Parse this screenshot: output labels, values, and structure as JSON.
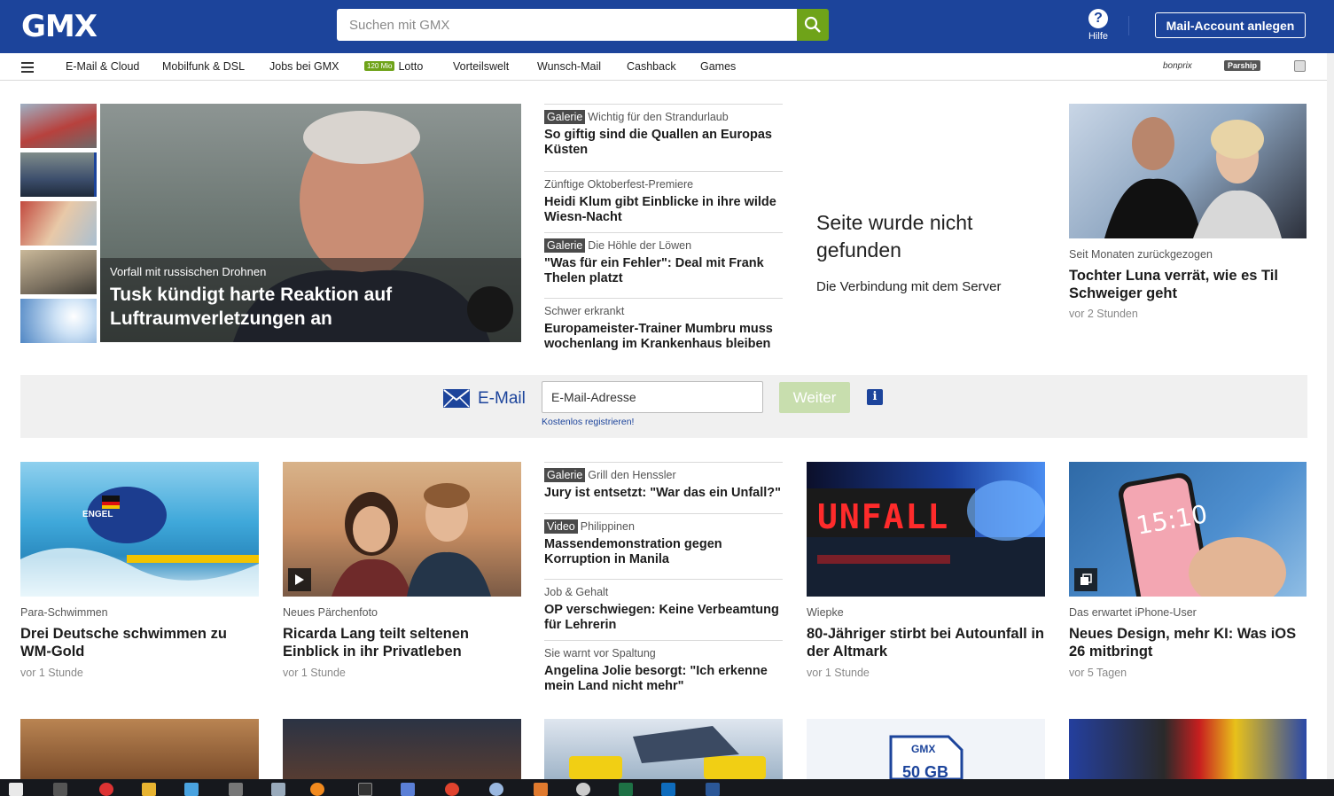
{
  "header": {
    "logo": "GMX",
    "search_placeholder": "Suchen mit GMX",
    "help_label": "Hilfe",
    "help_icon": "?",
    "account_button": "Mail-Account anlegen"
  },
  "nav": {
    "items": [
      "E-Mail & Cloud",
      "Mobilfunk & DSL",
      "Jobs bei GMX",
      "Lotto",
      "Vorteilswelt",
      "Wunsch-Mail",
      "Cashback",
      "Games"
    ],
    "lotto_badge": "120 Mio",
    "partners": [
      "bonprix",
      "Parship"
    ]
  },
  "hero": {
    "kicker": "Vorfall mit russischen Drohnen",
    "title": "Tusk kündigt harte Reaktion auf Luftraumverletzungen an"
  },
  "top_list": [
    {
      "tag": "Galerie",
      "kicker": "Wichtig für den Strandurlaub",
      "title": "So giftig sind die Quallen an Europas Küsten"
    },
    {
      "tag": "",
      "kicker": "Zünftige Oktoberfest-Premiere",
      "title": "Heidi Klum gibt Einblicke in ihre wilde Wiesn-Nacht"
    },
    {
      "tag": "Galerie",
      "kicker": "Die Höhle der Löwen",
      "title": "\"Was für ein Fehler\": Deal mit Frank Thelen platzt"
    },
    {
      "tag": "",
      "kicker": "Schwer erkrankt",
      "title": "Europameister-Trainer Mumbru muss wochenlang im Krankenhaus bleiben"
    }
  ],
  "error_box": {
    "title": "Seite wurde nicht gefunden",
    "text": "Die Verbindung mit dem Server"
  },
  "right_article": {
    "kicker": "Seit Monaten zurückgezogen",
    "title": "Tochter Luna verrät, wie es Til Schweiger geht",
    "time": "vor 2 Stunden"
  },
  "login": {
    "label": "E-Mail",
    "email_placeholder": "E-Mail-Adresse",
    "submit": "Weiter",
    "info_icon": "i",
    "register_link": "Kostenlos registrieren!"
  },
  "cards": [
    {
      "kicker": "Para-Schwimmen",
      "title": "Drei Deutsche schwimmen zu WM-Gold",
      "time": "vor 1 Stunde"
    },
    {
      "kicker": "Neues Pärchenfoto",
      "title": "Ricarda Lang teilt seltenen Einblick in ihr Privatleben",
      "time": "vor 1 Stunde"
    },
    {
      "kicker": "Wiepke",
      "title": "80-Jähriger stirbt bei Autounfall in der Altmark",
      "time": "vor 1 Stunde"
    },
    {
      "kicker": "Das erwartet iPhone-User",
      "title": "Neues Design, mehr KI: Was iOS 26 mitbringt",
      "time": "vor 5 Tagen"
    }
  ],
  "mid_list": [
    {
      "tag": "Galerie",
      "kicker": "Grill den Henssler",
      "title": "Jury ist entsetzt: \"War das ein Unfall?\""
    },
    {
      "tag": "Video",
      "kicker": "Philippinen",
      "title": "Massendemonstration gegen Korruption in Manila"
    },
    {
      "tag": "",
      "kicker": "Job & Gehalt",
      "title": "OP verschwiegen: Keine Verbeamtung für Lehrerin"
    },
    {
      "tag": "",
      "kicker": "Sie warnt vor Spaltung",
      "title": "Angelina Jolie besorgt: \"Ich erkenne mein Land nicht mehr\""
    }
  ],
  "image_text": {
    "swim_cap": "ENGEL",
    "unfall_sign": "UNFALL",
    "phone_time": "15:10",
    "sim_brand": "GMX",
    "sim_size": "50 GB"
  },
  "colors": {
    "brand_blue": "#1c449b",
    "accent_green": "#6fa319"
  }
}
